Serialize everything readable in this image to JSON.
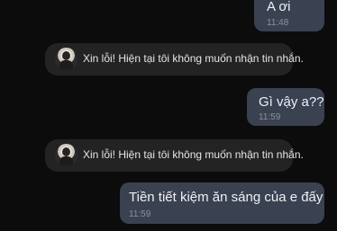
{
  "messages": [
    {
      "type": "outgoing",
      "text": "A ơi",
      "time": "11:48"
    },
    {
      "type": "system",
      "text": "Xin lỗi! Hiện tại tôi không muốn nhận tin nhắn."
    },
    {
      "type": "outgoing",
      "text": "Gì vậy a??",
      "time": "11:59"
    },
    {
      "type": "system",
      "text": "Xin lỗi! Hiện tại tôi không muốn nhận tin nhắn."
    },
    {
      "type": "outgoing",
      "text": "Tiền tiết kiệm ăn sáng của e đấy",
      "time": "11:59"
    }
  ],
  "colors": {
    "background": "#0c0c0c",
    "outgoing_bubble": "#3a4150",
    "system_bubble": "#232323",
    "timestamp": "#8a93a3"
  }
}
